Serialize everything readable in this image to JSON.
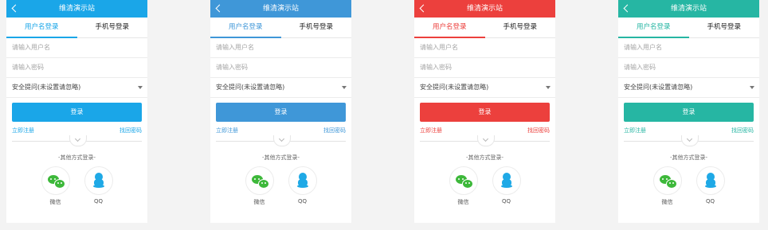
{
  "screens": [
    {
      "accent": "#1aa6e8",
      "header_bg": "#1aa6e8"
    },
    {
      "accent": "#3f97d8",
      "header_bg": "#3f97d8"
    },
    {
      "accent": "#ec403d",
      "header_bg": "#ec403d"
    },
    {
      "accent": "#26b6a3",
      "header_bg": "#26b6a3"
    }
  ],
  "header": {
    "title": "维清演示站"
  },
  "tabs": {
    "username": "用户名登录",
    "phone": "手机号登录"
  },
  "form": {
    "username_placeholder": "请输入用户名",
    "password_placeholder": "请输入密码",
    "security_question": "安全提问(未设置请忽略)",
    "login_label": "登录"
  },
  "links": {
    "register": "立即注册",
    "forgot": "找回密码"
  },
  "other": {
    "label": "-其他方式登录-",
    "wechat": "微信",
    "qq": "QQ"
  },
  "icons": {
    "back": "back-arrow-icon",
    "caret": "caret-down-icon",
    "toggle": "chevron-down-icon",
    "wechat": "wechat-icon",
    "qq": "qq-icon"
  }
}
